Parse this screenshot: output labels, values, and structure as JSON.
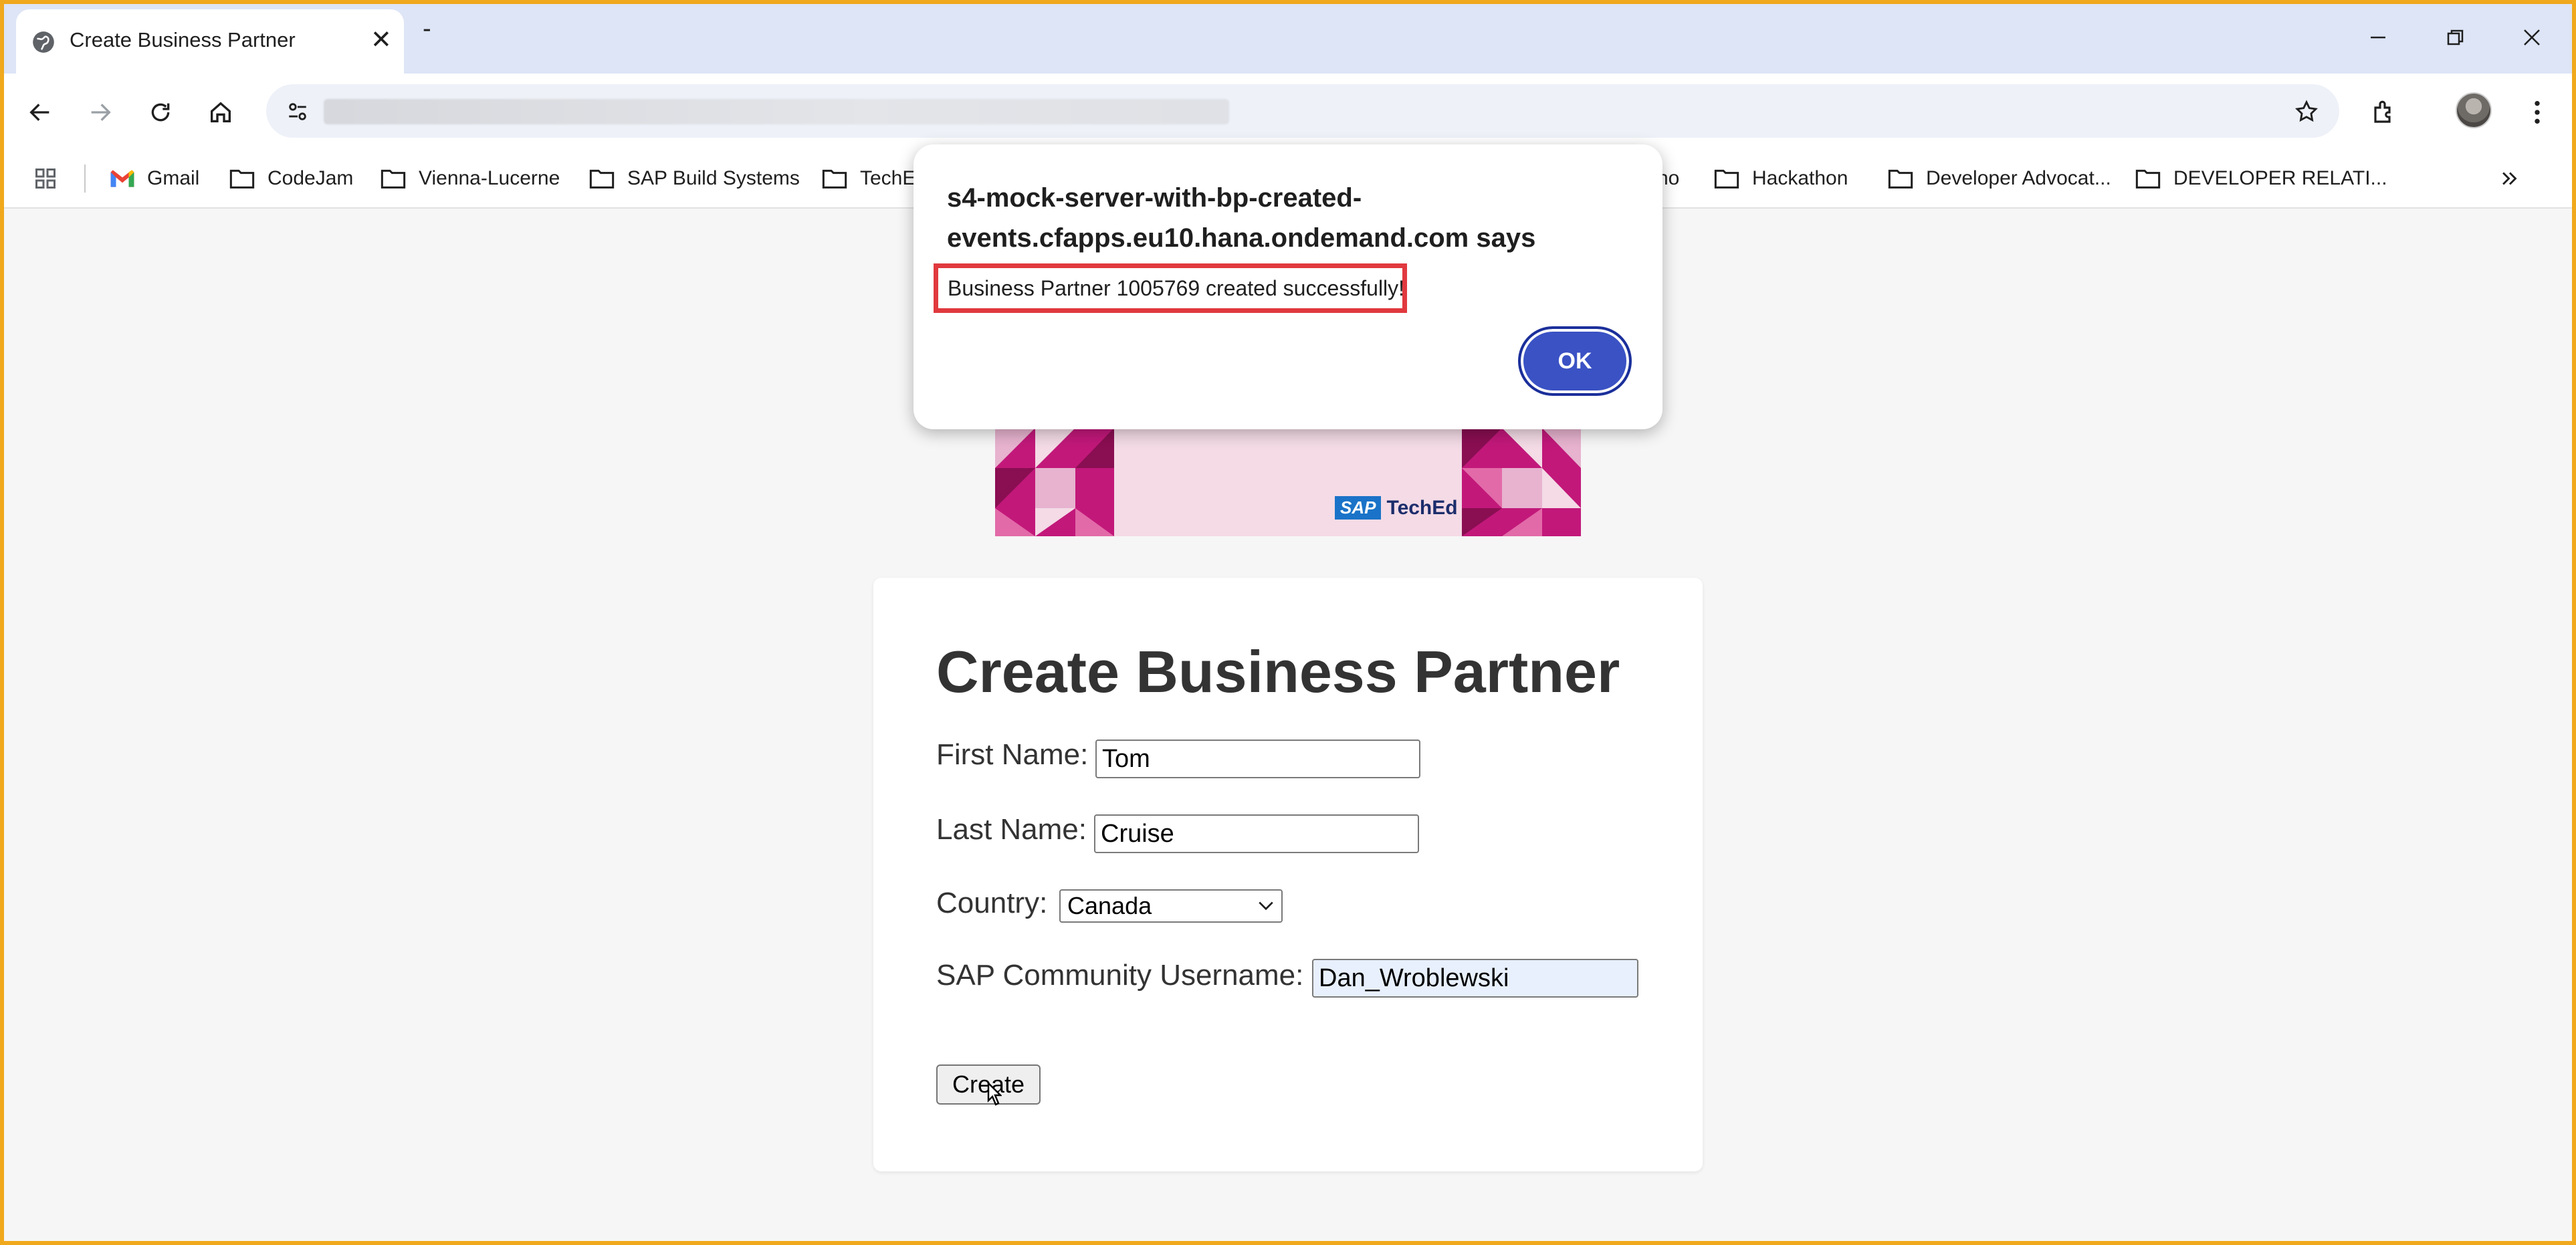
{
  "browser": {
    "tab_title": "Create Business Partner",
    "new_tab_label": "-",
    "bookmarks": [
      {
        "label": "Gmail",
        "icon": "gmail-icon"
      },
      {
        "label": "CodeJam",
        "icon": "folder-icon"
      },
      {
        "label": "Vienna-Lucerne",
        "icon": "folder-icon"
      },
      {
        "label": "SAP Build Systems",
        "icon": "folder-icon"
      },
      {
        "label": "TechE",
        "icon": "folder-icon"
      },
      {
        "label": "no",
        "icon": ""
      },
      {
        "label": "Hackathon",
        "icon": "folder-icon"
      },
      {
        "label": "Developer Advocat...",
        "icon": "folder-icon"
      },
      {
        "label": "DEVELOPER RELATI...",
        "icon": "folder-icon"
      }
    ]
  },
  "dialog": {
    "title": "s4-mock-server-with-bp-created-events.cfapps.eu10.hana.ondemand.com says",
    "message": "Business Partner 1005769 created successfully!",
    "ok_label": "OK"
  },
  "banner": {
    "sap": "SAP",
    "teched": "TechEd"
  },
  "form": {
    "heading": "Create Business Partner",
    "first_name_label": "First Name:",
    "first_name_value": "Tom",
    "last_name_label": "Last Name:",
    "last_name_value": "Cruise",
    "country_label": "Country:",
    "country_value": "Canada",
    "username_label": "SAP Community Username:",
    "username_value": "Dan_Wroblewski",
    "create_label": "Create"
  },
  "colors": {
    "accent_frame": "#f0a81c",
    "dialog_ok": "#3a52c4",
    "highlight_box": "#e0393e",
    "banner_magenta": "#c2187a"
  }
}
